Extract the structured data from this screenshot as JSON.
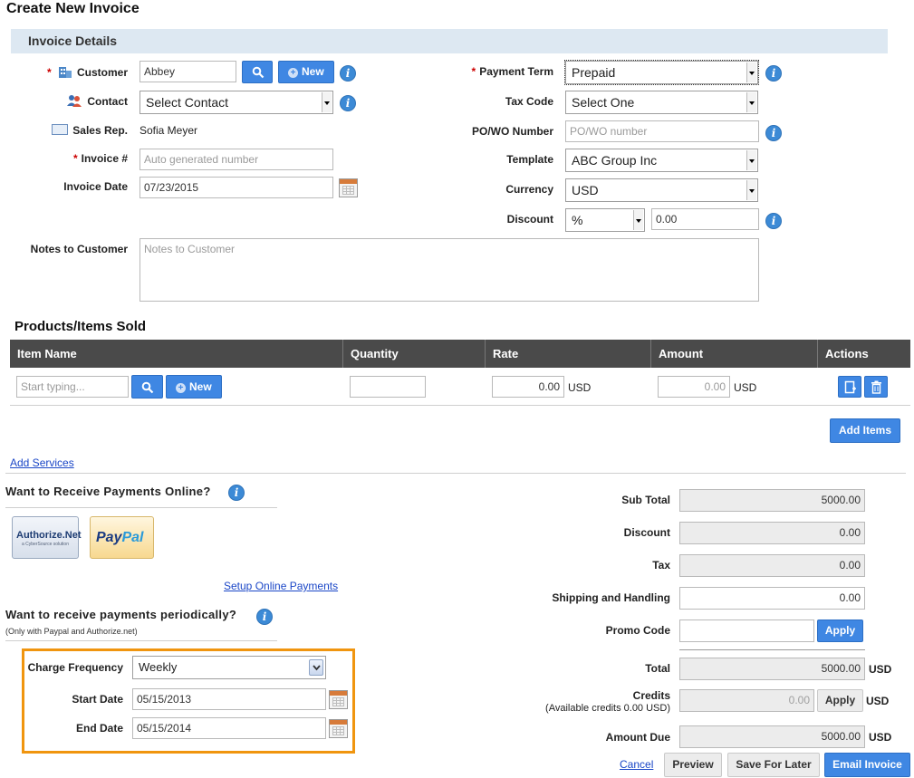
{
  "page": {
    "title": "Create New Invoice"
  },
  "invoice_details": {
    "heading": "Invoice Details",
    "customer": {
      "label": "Customer",
      "value": "Abbey",
      "new_label": "New"
    },
    "contact": {
      "label": "Contact",
      "value": "Select Contact"
    },
    "sales_rep": {
      "label": "Sales Rep.",
      "value": "Sofia Meyer"
    },
    "invoice_number": {
      "label": "Invoice #",
      "placeholder": "Auto generated number"
    },
    "invoice_date": {
      "label": "Invoice Date",
      "value": "07/23/2015"
    },
    "notes": {
      "label": "Notes to Customer",
      "placeholder": "Notes to Customer"
    },
    "payment_term": {
      "label": "Payment Term",
      "value": "Prepaid"
    },
    "tax_code": {
      "label": "Tax Code",
      "value": "Select One"
    },
    "po_wo": {
      "label": "PO/WO Number",
      "placeholder": "PO/WO number"
    },
    "template": {
      "label": "Template",
      "value": "ABC Group Inc"
    },
    "currency": {
      "label": "Currency",
      "value": "USD"
    },
    "discount": {
      "label": "Discount",
      "type": "%",
      "value": "0.00"
    }
  },
  "products": {
    "heading": "Products/Items Sold",
    "columns": [
      "Item Name",
      "Quantity",
      "Rate",
      "Amount",
      "Actions"
    ],
    "row": {
      "item_placeholder": "Start typing...",
      "new_label": "New",
      "quantity": "",
      "rate": "0.00",
      "rate_currency": "USD",
      "amount": "0.00",
      "amount_currency": "USD"
    },
    "add_items": "Add Items",
    "add_services": "Add Services"
  },
  "online_payments": {
    "heading": "Want to Receive Payments Online?",
    "authorize_net": "Authorize.Net",
    "authorize_net_sub": "a CyberSource solution",
    "paypal_pay": "Pay",
    "paypal_pal": "Pal",
    "setup_link": "Setup Online Payments"
  },
  "periodic": {
    "heading": "Want to receive payments periodically?",
    "note": "(Only with Paypal and Authorize.net)",
    "frequency": {
      "label": "Charge Frequency",
      "value": "Weekly"
    },
    "start_date": {
      "label": "Start Date",
      "value": "05/15/2013"
    },
    "end_date": {
      "label": "End Date",
      "value": "05/15/2014"
    }
  },
  "summary": {
    "sub_total": {
      "label": "Sub Total",
      "value": "5000.00"
    },
    "discount": {
      "label": "Discount",
      "value": "0.00"
    },
    "tax": {
      "label": "Tax",
      "value": "0.00"
    },
    "shipping": {
      "label": "Shipping and Handling",
      "value": "0.00"
    },
    "promo": {
      "label": "Promo Code",
      "value": "",
      "apply": "Apply"
    },
    "total": {
      "label": "Total",
      "value": "5000.00",
      "currency": "USD"
    },
    "credits": {
      "label": "Credits",
      "sub": "(Available credits  0.00  USD)",
      "value": "0.00",
      "apply": "Apply",
      "currency": "USD"
    },
    "amount_due": {
      "label": "Amount Due",
      "value": "5000.00",
      "currency": "USD"
    }
  },
  "footer": {
    "cancel": "Cancel",
    "preview": "Preview",
    "save_later": "Save For Later",
    "email": "Email Invoice"
  },
  "colors": {
    "accent": "#3f87e3",
    "header_band": "#dde8f2",
    "table_header": "#4a4a4a",
    "highlight_border": "#f0950f",
    "required": "#cc0000"
  }
}
